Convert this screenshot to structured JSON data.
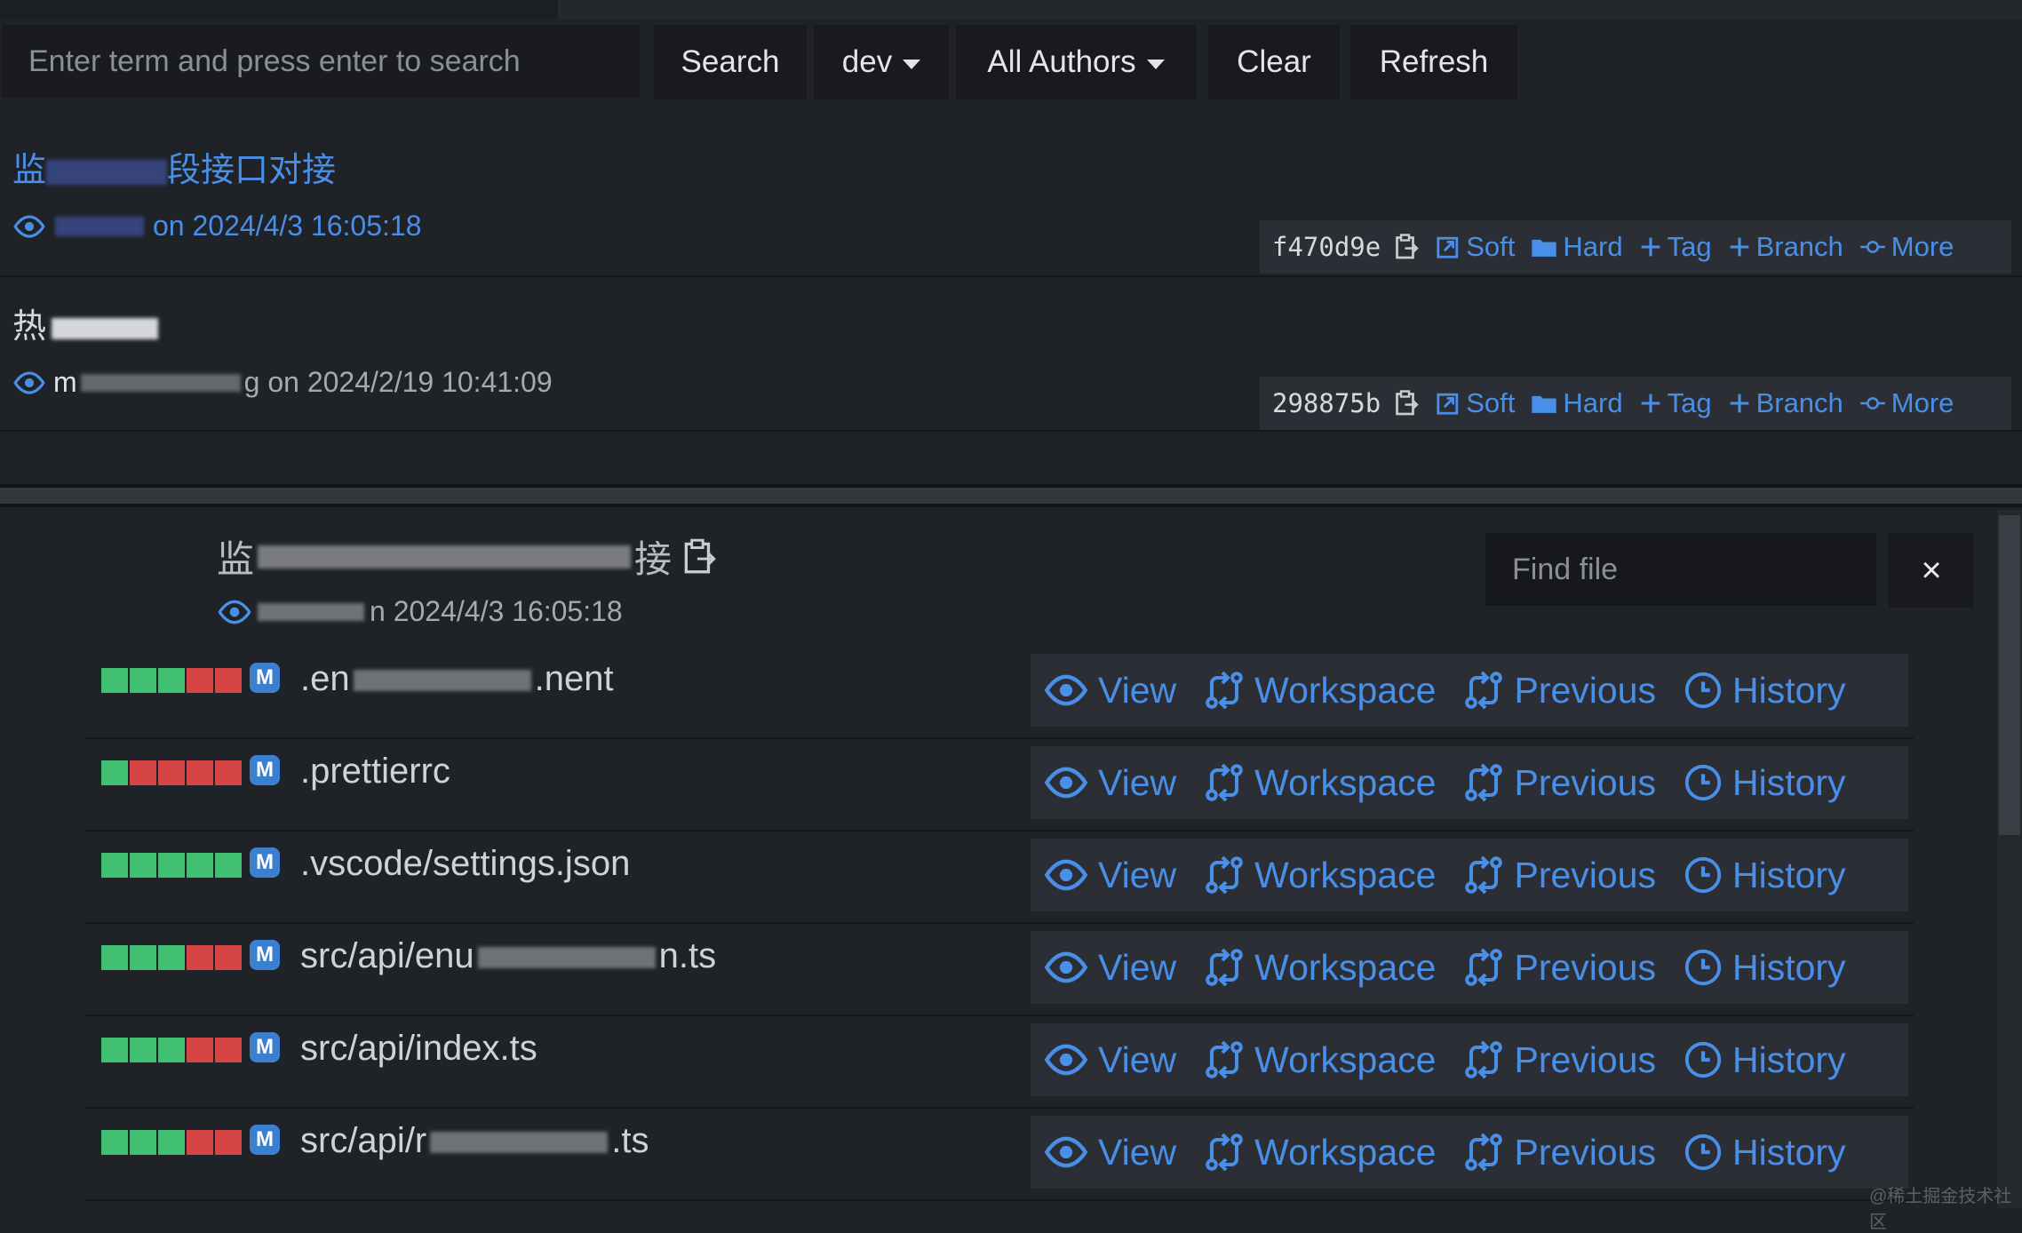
{
  "toolbar": {
    "search_placeholder": "Enter term and press enter to search",
    "search_label": "Search",
    "branch_label": "dev",
    "authors_label": "All Authors",
    "clear_label": "Clear",
    "refresh_label": "Refresh"
  },
  "commits": [
    {
      "title_prefix": "监",
      "title_suffix": "段接口对接",
      "meta": "on 2024/4/3 16:05:18",
      "hash": "f470d9e"
    },
    {
      "title_prefix": "热",
      "title_suffix": "",
      "meta_prefix": "m",
      "meta": "g on 2024/2/19 10:41:09",
      "hash": "298875b"
    }
  ],
  "commit_actions": {
    "soft": "Soft",
    "hard": "Hard",
    "tag": "Tag",
    "branch": "Branch",
    "more": "More"
  },
  "details": {
    "title_prefix": "监",
    "title_suffix": "接",
    "meta": "n 2024/4/3 16:05:18",
    "find_placeholder": "Find file",
    "close_label": "×"
  },
  "file_actions": {
    "view": "View",
    "workspace": "Workspace",
    "previous": "Previous",
    "history": "History"
  },
  "files": [
    {
      "badge": "M",
      "name_a": ".en",
      "name_b": ".nent",
      "bars": [
        "green",
        "green",
        "green",
        "red",
        "red"
      ]
    },
    {
      "badge": "M",
      "name_a": ".prettierrc",
      "name_b": "",
      "bars": [
        "green",
        "red",
        "red",
        "red",
        "red"
      ]
    },
    {
      "badge": "M",
      "name_a": ".vscode/settings.json",
      "name_b": "",
      "bars": [
        "green",
        "green",
        "green",
        "green",
        "green"
      ]
    },
    {
      "badge": "M",
      "name_a": "src/api/enu",
      "name_b": "n.ts",
      "bars": [
        "green",
        "green",
        "green",
        "red",
        "red"
      ]
    },
    {
      "badge": "M",
      "name_a": "src/api/index.ts",
      "name_b": "",
      "bars": [
        "green",
        "green",
        "green",
        "red",
        "red"
      ]
    },
    {
      "badge": "M",
      "name_a": "src/api/r",
      "name_b": ".ts",
      "bars": [
        "green",
        "green",
        "green",
        "red",
        "red"
      ]
    }
  ],
  "watermark": "@稀土掘金技术社区",
  "colors": {
    "accent": "#4a8fe7",
    "green": "#3fbf6f",
    "red": "#d64545",
    "badge": "#3b7fd0"
  }
}
